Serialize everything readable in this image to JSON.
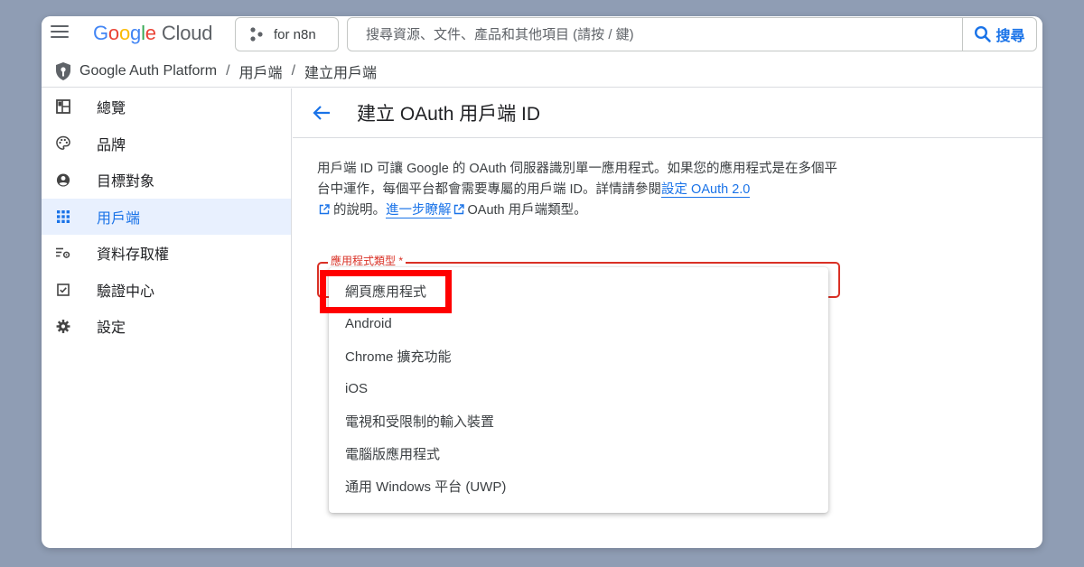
{
  "topbar": {
    "logo_letters": [
      "G",
      "o",
      "o",
      "g",
      "l",
      "e"
    ],
    "logo_suffix": "Cloud",
    "project_label": "for n8n",
    "search_placeholder": "搜尋資源、文件、產品和其他項目 (請按 / 鍵)",
    "search_button": "搜尋"
  },
  "breadcrumb": {
    "items": [
      "Google Auth Platform",
      "用戶端",
      "建立用戶端"
    ],
    "separator": "/"
  },
  "sidebar": {
    "items": [
      {
        "label": "總覽",
        "icon": "dashboard-icon"
      },
      {
        "label": "品牌",
        "icon": "palette-icon"
      },
      {
        "label": "目標對象",
        "icon": "account-circle-icon"
      },
      {
        "label": "用戶端",
        "icon": "apps-grid-icon",
        "active": true
      },
      {
        "label": "資料存取權",
        "icon": "settings-list-icon"
      },
      {
        "label": "驗證中心",
        "icon": "checkbox-icon"
      },
      {
        "label": "設定",
        "icon": "gear-icon"
      }
    ]
  },
  "main": {
    "title": "建立 OAuth 用戶端 ID",
    "description": {
      "text1": "用戶端 ID 可讓 Google 的 OAuth 伺服器識別單一應用程式。如果您的應用程式是在多個平台中運作，每個平台都會需要專屬的用戶端 ID。詳情請參閱",
      "link1": "設定 OAuth 2.0",
      "text2": "的說明。",
      "link2": "進一步瞭解",
      "text3": "OAuth 用戶端類型。"
    },
    "select": {
      "label": "應用程式類型 *",
      "options": [
        "網頁應用程式",
        "Android",
        "Chrome 擴充功能",
        "iOS",
        "電視和受限制的輸入裝置",
        "電腦版應用程式",
        "通用 Windows 平台 (UWP)"
      ]
    }
  },
  "colors": {
    "background": "#8f9db4",
    "accent": "#1a73e8",
    "error": "#d93025",
    "highlight": "#ff0000",
    "active_nav_bg": "#e8f0fe"
  }
}
